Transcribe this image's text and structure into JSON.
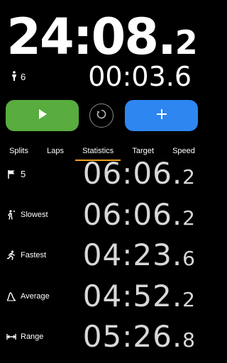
{
  "timer": {
    "main_whole": "24:08.",
    "main_frac": "2",
    "lap_count": "6",
    "lap_time": "00:03.6"
  },
  "controls": {
    "start_icon": "play-icon",
    "reset_icon": "reset-icon",
    "add_icon": "plus-icon",
    "start_color": "#58ad3e",
    "add_color": "#2e86f0"
  },
  "tabs": [
    {
      "label": "Splits",
      "active": false
    },
    {
      "label": "Laps",
      "active": false
    },
    {
      "label": "Statistics",
      "active": true
    },
    {
      "label": "Target",
      "active": false
    },
    {
      "label": "Speed",
      "active": false
    }
  ],
  "statistics": [
    {
      "icon": "flag-icon",
      "label": "5",
      "whole": "06:06.",
      "frac": "2"
    },
    {
      "icon": "slow-walker-icon",
      "label": "Slowest",
      "whole": "06:06.",
      "frac": "2"
    },
    {
      "icon": "runner-icon",
      "label": "Fastest",
      "whole": "04:23.",
      "frac": "6"
    },
    {
      "icon": "average-icon",
      "label": "Average",
      "whole": "04:52.",
      "frac": "2"
    },
    {
      "icon": "range-icon",
      "label": "Range",
      "whole": "05:26.",
      "frac": "8"
    }
  ]
}
